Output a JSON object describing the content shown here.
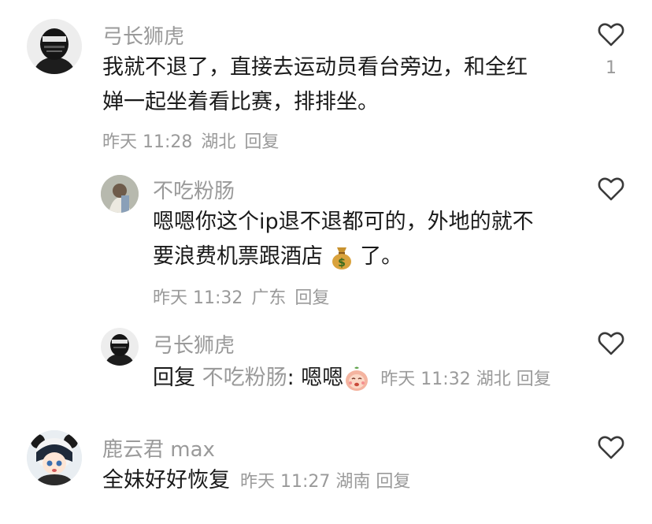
{
  "comments": [
    {
      "username": "弓长狮虎",
      "text_line1": "我就不退了，直接去运动员看台旁边，和全红",
      "text_line2": "婵一起坐着看比赛，排排坐。",
      "time": "昨天 11:28",
      "location": "湖北",
      "reply_label": "回复",
      "like_count": "1"
    },
    {
      "username": "不吃粉肠",
      "text_line1": "嗯嗯你这个ip退不退都可的，外地的就不",
      "text_line2": "要浪费机票跟酒店",
      "text_tail": "了。",
      "emoji": "money-bag",
      "time": "昨天 11:32",
      "location": "广东",
      "reply_label": "回复"
    },
    {
      "username": "弓长狮虎",
      "prefix": "回复",
      "mention": "不吃粉肠",
      "colon": ":",
      "text": "嗯嗯",
      "emoji": "peach-face",
      "time": "昨天 11:32",
      "location": "湖北",
      "reply_label": "回复"
    },
    {
      "username": "鹿云君 max",
      "text": "全妹好好恢复",
      "time": "昨天 11:27",
      "location": "湖南",
      "reply_label": "回复"
    }
  ],
  "colors": {
    "meta": "#9a9a9a",
    "text": "#1a1a1a"
  }
}
